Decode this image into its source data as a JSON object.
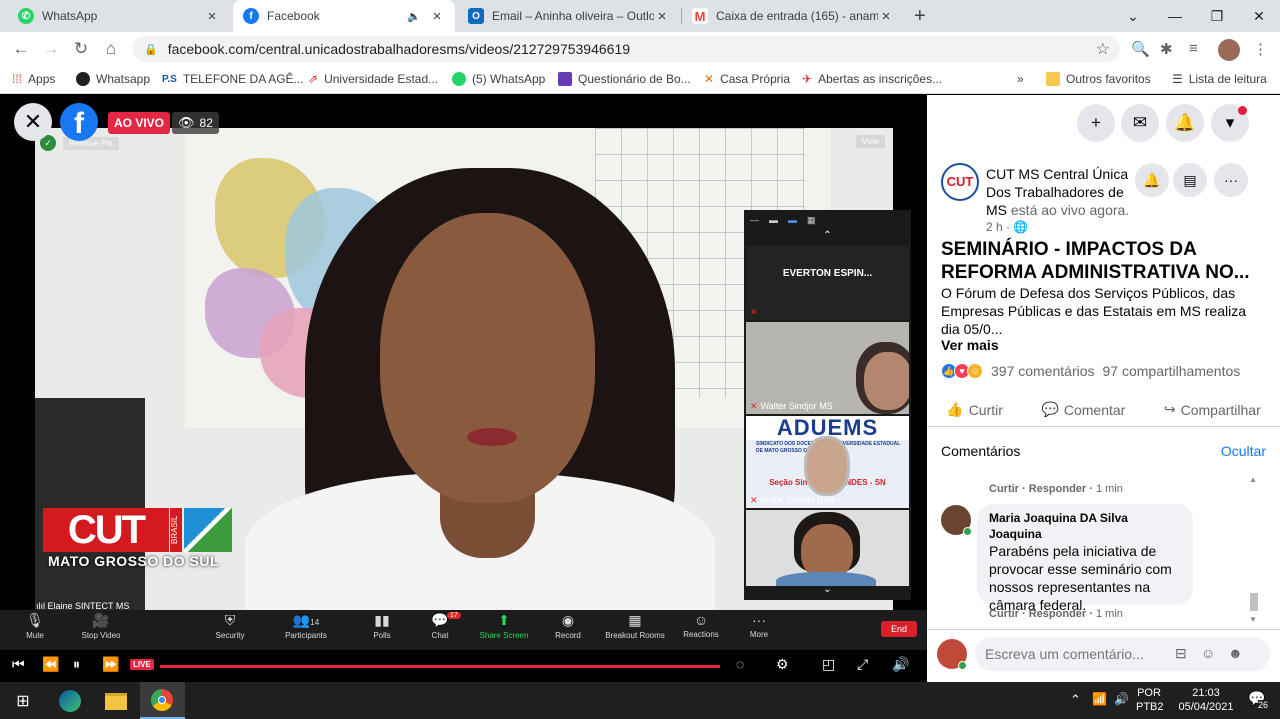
{
  "tabs": [
    {
      "label": "WhatsApp",
      "icon": "whatsapp-icon",
      "color": "#25d366"
    },
    {
      "label": "Facebook",
      "icon": "facebook-icon",
      "color": "#1877f2"
    },
    {
      "label": "Email – Aninha oliveira – Outlook",
      "icon": "outlook-icon",
      "color": "#0f6cbd"
    },
    {
      "label": "Caixa de entrada (165) - anamari",
      "icon": "gmail-icon",
      "color": "#ea4335"
    }
  ],
  "address": {
    "url": "facebook.com/central.unicadostrabalhadoresms/videos/212729753946619"
  },
  "bookmarks": [
    {
      "label": "Apps"
    },
    {
      "label": "Whatsapp"
    },
    {
      "label": "TELEFONE DA AGÊ..."
    },
    {
      "label": "Universidade Estad..."
    },
    {
      "label": "(5) WhatsApp"
    },
    {
      "label": "Questionário de Bo..."
    },
    {
      "label": "Casa Própria"
    },
    {
      "label": "Abertas as inscrições..."
    },
    {
      "label": "»"
    },
    {
      "label": "Outros favoritos"
    },
    {
      "label": "Lista de leitura"
    }
  ],
  "video": {
    "live_label": "AO VIVO",
    "viewers": "82",
    "remove_pin": "Remove Pin",
    "view": "View",
    "logo_text": "CUT",
    "logo_sub": "BRASIL",
    "logo_region": "MATO GROSSO DO SUL",
    "speaker": "Elaine SINTECT MS"
  },
  "zoom_panel": {
    "tile1": "EVERTON  ESPIN...",
    "tile2": "Walter Sindjor MS",
    "tile3_banner": "ADUEMS",
    "tile3_small": "SINDICATO DOS DOCENTES DA UNIVERSIDADE ESTADUAL DE MATO GROSSO DO SUL",
    "tile3_footer": "Seção Sindical do ANDES - SN",
    "tile3": "Profa. Cassia Reis -..."
  },
  "zoom_toolbar": {
    "mute": "Mute",
    "stop_video": "Stop Video",
    "security": "Security",
    "participants": "Participants",
    "participants_count": "14",
    "polls": "Polls",
    "chat": "Chat",
    "chat_badge": "17",
    "share": "Share Screen",
    "record": "Record",
    "breakout": "Breakout Rooms",
    "reactions": "Reactions",
    "more": "More",
    "end": "End"
  },
  "player": {
    "live": "LIVE",
    "progress": 1.0
  },
  "post": {
    "page_name": "CUT MS Central Única Dos Trabalhadores de MS",
    "live_now": "está ao vivo agora.",
    "time": "2 h",
    "title": "SEMINÁRIO - IMPACTOS DA REFORMA ADMINISTRATIVA NO...",
    "description": "O Fórum de Defesa dos Serviços Públicos, das Empresas Públicas e das Estatais em MS realiza dia 05/0...",
    "see_more": "Ver mais",
    "comments_count": "397 comentários",
    "shares_count": "97 compartilhamentos",
    "like": "Curtir",
    "comment": "Comentar",
    "share": "Compartilhar",
    "comments_heading": "Comentários",
    "hide": "Ocultar",
    "avatar_text": "CUT"
  },
  "comments": [
    {
      "meta_like": "Curtir",
      "meta_reply": "Responder",
      "meta_time": "1 min"
    },
    {
      "author": "Maria Joaquina DA Silva Joaquina",
      "text": "Parabéns pela iniciativa de provocar esse seminário com nossos representantes na câmara federal.",
      "meta_like": "Curtir",
      "meta_reply": "Responder",
      "meta_time": "1 min"
    }
  ],
  "composer": {
    "placeholder": "Escreva um comentário..."
  },
  "taskbar": {
    "lang": "POR",
    "layout": "PTB2",
    "time": "21:03",
    "date": "05/04/2021",
    "notifications": "26"
  }
}
